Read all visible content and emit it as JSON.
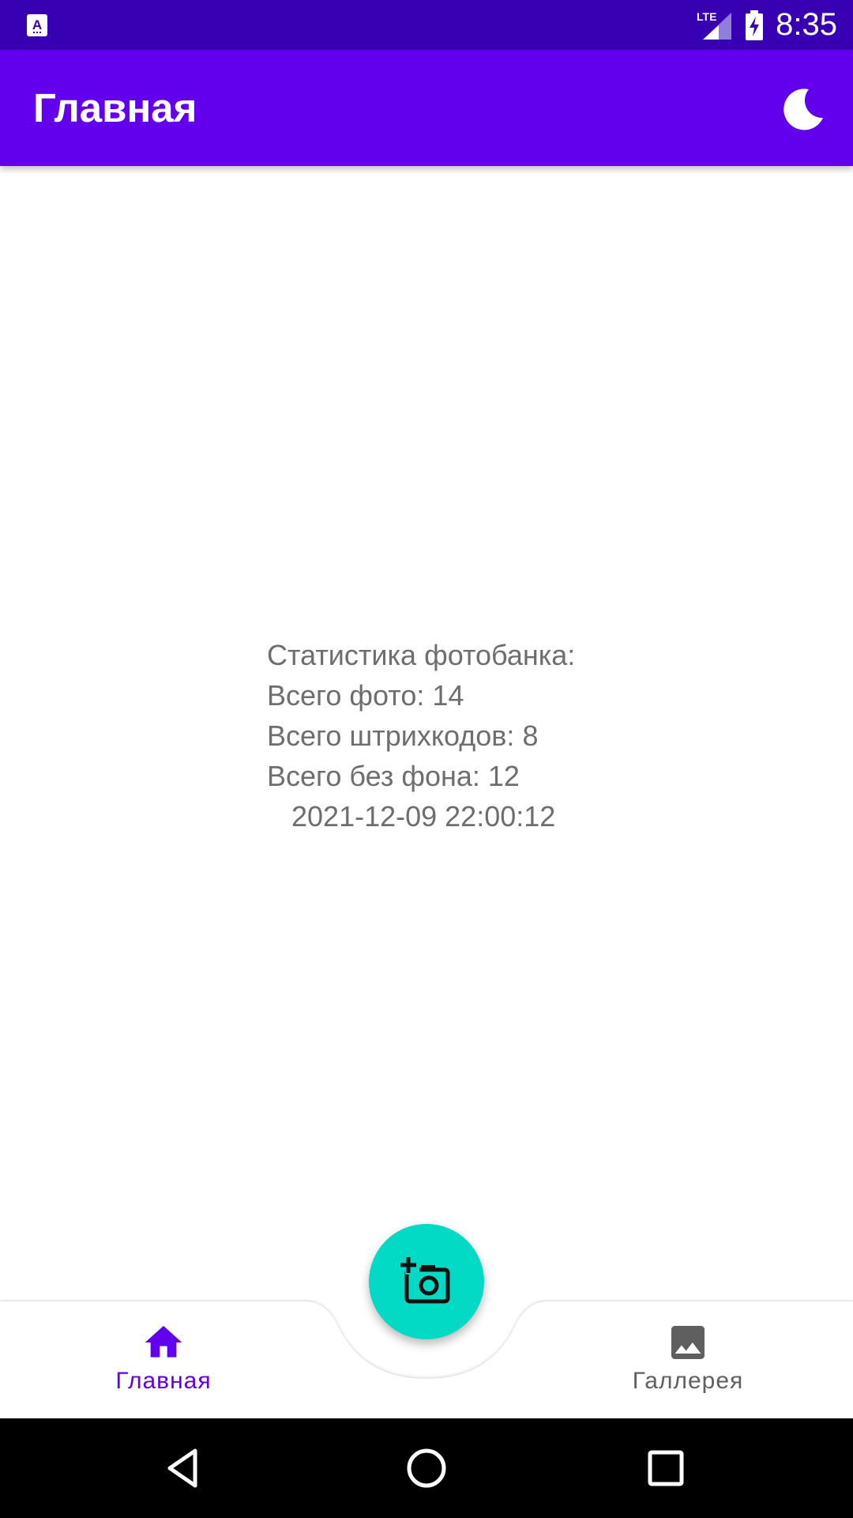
{
  "status_bar": {
    "time": "8:35",
    "network_label": "LTE"
  },
  "app_bar": {
    "title": "Главная"
  },
  "stats": {
    "heading": "Статистика фотобанка:",
    "total_photos": "Всего фото: 14",
    "total_barcodes": "Всего штрихкодов: 8",
    "total_no_background": "Всего без фона: 12",
    "timestamp": "2021-12-09 22:00:12"
  },
  "bottom_nav": {
    "items": [
      {
        "label": "Главная",
        "icon": "home-icon",
        "active": true
      },
      {
        "label": "Галлерея",
        "icon": "image-icon",
        "active": false
      }
    ]
  },
  "fab": {
    "icon": "add-photo-icon"
  },
  "colors": {
    "status_bar": "#3700b3",
    "primary": "#6200ee",
    "accent": "#03dac5",
    "text_secondary": "#6e6e6e",
    "nav_inactive": "#5f5f5f"
  }
}
